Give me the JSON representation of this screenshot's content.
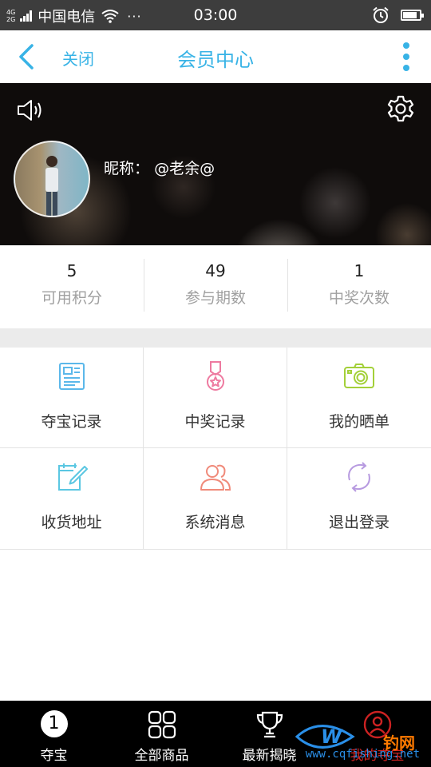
{
  "status_bar": {
    "net_top": "4G",
    "net_bottom": "2G",
    "carrier": "中国电信",
    "more": "···",
    "time": "03:00",
    "battery_level": 0.85
  },
  "nav": {
    "close_label": "关闭",
    "title": "会员中心",
    "accent_color": "#38b3e6"
  },
  "profile": {
    "nickname_label": "昵称：",
    "nickname": "@老余@"
  },
  "stats": [
    {
      "value": "5",
      "label": "可用积分"
    },
    {
      "value": "49",
      "label": "参与期数"
    },
    {
      "value": "1",
      "label": "中奖次数"
    }
  ],
  "menu": [
    {
      "label": "夺宝记录",
      "icon": "document-icon",
      "color": "#5bb8ea"
    },
    {
      "label": "中奖记录",
      "icon": "medal-icon",
      "color": "#ee7aa0"
    },
    {
      "label": "我的晒单",
      "icon": "camera-icon",
      "color": "#a3d039"
    },
    {
      "label": "收货地址",
      "icon": "edit-note-icon",
      "color": "#5bc7e2"
    },
    {
      "label": "系统消息",
      "icon": "users-icon",
      "color": "#f08a7a"
    },
    {
      "label": "退出登录",
      "icon": "refresh-icon",
      "color": "#b79ae0"
    }
  ],
  "tabs": [
    {
      "label": "夺宝",
      "icon": "home-number-icon",
      "icon_text": "1"
    },
    {
      "label": "全部商品",
      "icon": "grid-icon"
    },
    {
      "label": "最新揭晓",
      "icon": "trophy-icon"
    },
    {
      "label": "我的夺宝",
      "icon": "user-icon"
    }
  ],
  "watermark": {
    "brand": "钓网",
    "url": "www.cqfishing.net"
  }
}
